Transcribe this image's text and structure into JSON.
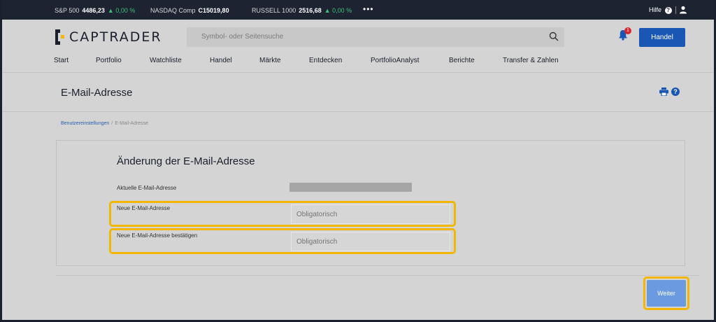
{
  "ticker": {
    "items": [
      {
        "name": "S&P 500",
        "value": "4486,23",
        "change": "▲ 0,00 %"
      },
      {
        "name": "NASDAQ Comp",
        "value": "C15019,80",
        "change": ""
      },
      {
        "name": "RUSSELL 1000",
        "value": "2516,68",
        "change": "▲ 0,00 %"
      }
    ],
    "more": "•••",
    "help_label": "Hilfe",
    "help_icon": "?"
  },
  "header": {
    "logo_text": "CAPTRADER",
    "search_placeholder": "Symbol- oder Seitensuche",
    "notification_count": "1",
    "trade_button": "Handel"
  },
  "nav": [
    "Start",
    "Portfolio",
    "Watchliste",
    "Handel",
    "Märkte",
    "Entdecken",
    "PortfolioAnalyst",
    "Berichte",
    "Transfer & Zahlen"
  ],
  "page": {
    "title": "E-Mail-Adresse",
    "breadcrumb": {
      "parent": "Benutzereinstellungen",
      "separator": "/",
      "current": "E-Mail-Adresse"
    }
  },
  "form": {
    "title": "Änderung der E-Mail-Adresse",
    "current_label": "Aktuelle E-Mail-Adresse",
    "new_label": "Neue E-Mail-Adresse",
    "new_placeholder": "Obligatorisch",
    "confirm_label": "Neue E-Mail-Adresse bestätigen",
    "confirm_placeholder": "Obligatorisch",
    "next_button": "Weiter"
  },
  "colors": {
    "accent": "#1a56b3",
    "highlight": "#f2b705",
    "positive": "#3fbf7a",
    "ticker_bg": "#1e2332"
  }
}
